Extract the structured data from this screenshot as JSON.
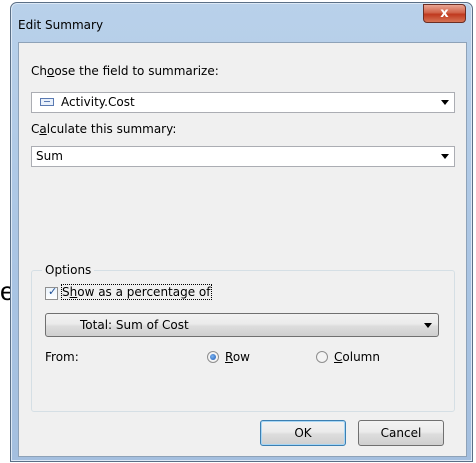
{
  "background": {
    "partial_text": "e"
  },
  "dialog": {
    "title": "Edit Summary",
    "close_glyph": "x",
    "field_label_pre": "Ch",
    "field_label_key": "o",
    "field_label_post": "ose the field to summarize:",
    "field_value": "Activity.Cost",
    "calc_label_pre": "C",
    "calc_label_key": "a",
    "calc_label_post": "lculate this summary:",
    "calc_value": "Sum",
    "options": {
      "legend": "Options",
      "show_pct_checked": true,
      "show_pct_label_pre": "S",
      "show_pct_label_key": "h",
      "show_pct_label_post": "ow as a percentage of",
      "pct_target_value": "Total: Sum of Cost",
      "from_label": "From:",
      "row_label_key": "R",
      "row_label_post": "ow",
      "row_selected": true,
      "column_label_key": "C",
      "column_label_post": "olumn",
      "column_selected": false
    },
    "ok_label": "OK",
    "cancel_label": "Cancel"
  }
}
